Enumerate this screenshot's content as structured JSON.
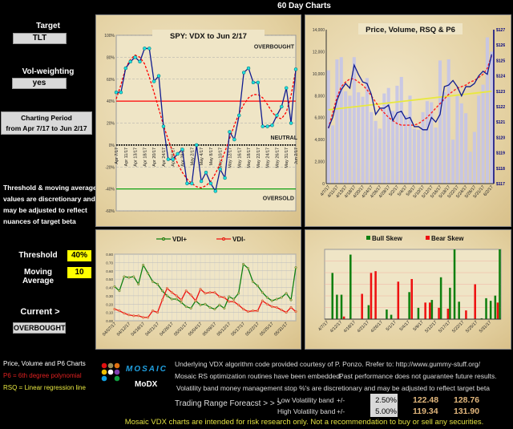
{
  "title": "60 Day Charts",
  "left": {
    "target_label": "Target",
    "target_value": "TLT",
    "vol_label": "Vol-weighting",
    "vol_value": "yes",
    "period_label": "Charting Period",
    "period_value": "from Apr 7/17 to Jun 2/17",
    "note_lines": [
      "Threshold & moving average",
      "values are discretionary and",
      "may be adjusted to reflect",
      "nuances of target beta"
    ],
    "threshold_label": "Threshold",
    "threshold_value": "40%",
    "ma_label": "Moving Average",
    "ma_value": "10",
    "current_label": "Current >",
    "current_value": "OVERBOUGHT",
    "legend_title": "Price, Volume and P6 Charts",
    "legend_p6": "P6 = 6th degree polynomial",
    "legend_rsq": "RSQ = Linear regression line"
  },
  "colors": {
    "p6": "#ff2020",
    "rsq": "#e8e840",
    "bull": "#108010",
    "bear": "#ee1010",
    "vdx": "#101c90",
    "parchment": "#e8d8ae"
  },
  "chart_data": [
    {
      "type": "line",
      "title": "SPY:   VDX to Jun 2/17",
      "ylim": [
        -60,
        100
      ],
      "yticks": [
        "100%",
        "80%",
        "60%",
        "40%",
        "20%",
        "0%",
        "-20%",
        "-40%",
        "-60%"
      ],
      "xlabels": [
        "Apr 7/17",
        "Apr 11/17",
        "Apr 13/17",
        "Apr 18/17",
        "Apr 20/17",
        "Apr 24/17",
        "Apr 26/17",
        "Apr 28/17",
        "May 2/17",
        "May 4/17",
        "May 8/17",
        "May 10/17",
        "May 12/17",
        "May 16/17",
        "May 18/17",
        "May 22/17",
        "May 24/17",
        "May 26/17",
        "May 31/17",
        "Jun 2/17"
      ],
      "annotations": {
        "overbought": "OVERBOUGHT",
        "neutral": "NEUTRAL",
        "oversold": "OVERSOLD"
      },
      "threshold_high": 40,
      "threshold_low": -40,
      "vdx": [
        48,
        48,
        70,
        76,
        80,
        76,
        88,
        88,
        58,
        63,
        17,
        -13,
        -13,
        -8,
        -4,
        -35,
        -35,
        0,
        -33,
        -25,
        -35,
        -42,
        -22,
        -30,
        12,
        5,
        27,
        66,
        70,
        57,
        57,
        17,
        17,
        18,
        27,
        35,
        52,
        20,
        69
      ],
      "moving_average": [
        42,
        55,
        70,
        78,
        82,
        80,
        74,
        62,
        48,
        33,
        18,
        5,
        -7,
        -17,
        -25,
        -31,
        -35,
        -38,
        -39,
        -37,
        -33,
        -26,
        -17,
        -6,
        6,
        18,
        29,
        37,
        43,
        46,
        46,
        43,
        37,
        30,
        25,
        24,
        30,
        45,
        68
      ]
    },
    {
      "type": "bar",
      "title": "Price,  Volume, RSQ & P6",
      "ylim": [
        0,
        14000
      ],
      "y2lim": [
        117,
        127
      ],
      "yticks": [
        "14,000",
        "12,000",
        "10,000",
        "8,000",
        "6,000",
        "4,000",
        "2,000",
        "0"
      ],
      "y2ticks": [
        "$127",
        "$126",
        "$125",
        "$124",
        "$123",
        "$122",
        "$121",
        "$120",
        "$119",
        "$118",
        "$117"
      ],
      "xlabels": [
        "4/7/17",
        "4/11/17",
        "4/13/17",
        "4/18/17",
        "4/20/17",
        "4/24/17",
        "4/26/17",
        "4/28/17",
        "5/2/17",
        "5/4/17",
        "5/8/17",
        "5/10/17",
        "5/12/17",
        "5/16/17",
        "5/18/17",
        "5/22/17",
        "5/24/17",
        "5/26/17",
        "5/31/17",
        "6/2/17"
      ],
      "volume": [
        10300,
        5300,
        11300,
        11500,
        8400,
        8000,
        11500,
        8300,
        7900,
        9600,
        6500,
        5700,
        5000,
        8200,
        8700,
        6600,
        8900,
        9700,
        6200,
        8000,
        5000,
        4900,
        6500,
        7500,
        7400,
        5100,
        11200,
        8300,
        11300,
        4000,
        8000,
        7300,
        6400,
        2900,
        4700,
        8000,
        9000,
        13300,
        12000
      ],
      "price": [
        120.6,
        121.3,
        122.4,
        123.1,
        123.5,
        123.2,
        124.7,
        124.1,
        123.6,
        123.5,
        122.8,
        121.5,
        121.9,
        121.9,
        122.1,
        121.1,
        121.6,
        121.7,
        121.2,
        121.3,
        120.7,
        120.7,
        120.5,
        120.5,
        121.3,
        121.0,
        121.5,
        123.3,
        123.4,
        123.7,
        123.3,
        122.7,
        123.3,
        123.3,
        123.5,
        124.0,
        124.3,
        124.1,
        125.4
      ],
      "rsq": [
        121.8,
        123.0
      ],
      "p6": [
        120.6,
        121.6,
        122.6,
        123.3,
        123.6,
        123.8,
        123.8,
        123.6,
        123.4,
        123.1,
        122.7,
        122.3,
        121.9,
        121.6,
        121.3,
        121.1,
        120.9,
        120.8,
        120.8,
        120.8,
        120.8,
        120.9,
        121.1,
        121.3,
        121.6,
        121.9,
        122.2,
        122.5,
        122.8,
        123.0,
        123.2,
        123.3,
        123.4,
        123.6,
        123.7,
        123.9,
        124.1,
        124.5,
        125.3
      ]
    },
    {
      "type": "line",
      "ylim": [
        0,
        0.8
      ],
      "yticks": [
        "0.80",
        "0.70",
        "0.60",
        "0.50",
        "0.40",
        "0.30",
        "0.20",
        "0.10",
        "0.00"
      ],
      "xlabels": [
        "04/07/17",
        "04/12/17",
        "04/18/17",
        "04/21/17",
        "04/26/17",
        "05/01/17",
        "05/04/17",
        "05/09/17",
        "05/12/17",
        "05/17/17",
        "05/22/17",
        "05/25/17",
        "05/31/17"
      ],
      "series": [
        {
          "name": "VDI+",
          "values": [
            0.41,
            0.36,
            0.53,
            0.52,
            0.53,
            0.44,
            0.67,
            0.57,
            0.47,
            0.44,
            0.36,
            0.3,
            0.26,
            0.26,
            0.22,
            0.17,
            0.15,
            0.24,
            0.19,
            0.2,
            0.16,
            0.14,
            0.19,
            0.15,
            0.29,
            0.26,
            0.33,
            0.68,
            0.63,
            0.47,
            0.42,
            0.34,
            0.28,
            0.24,
            0.26,
            0.28,
            0.33,
            0.25,
            0.64
          ]
        },
        {
          "name": "VDI-",
          "values": [
            0.14,
            0.12,
            0.09,
            0.07,
            0.06,
            0.06,
            0.04,
            0.04,
            0.12,
            0.1,
            0.25,
            0.39,
            0.34,
            0.3,
            0.25,
            0.36,
            0.31,
            0.24,
            0.38,
            0.33,
            0.34,
            0.34,
            0.29,
            0.28,
            0.23,
            0.23,
            0.19,
            0.14,
            0.11,
            0.12,
            0.12,
            0.24,
            0.2,
            0.17,
            0.16,
            0.13,
            0.1,
            0.16,
            0.11
          ]
        }
      ]
    },
    {
      "type": "bar",
      "ylim": [
        0,
        80
      ],
      "xlabels": [
        "4/7/17",
        "4/12/17",
        "4/18/17",
        "4/21/17",
        "4/26/17",
        "5/1/17",
        "5/4/17",
        "5/9/17",
        "5/12/17",
        "5/17/17",
        "5/22/17",
        "5/25/17",
        "5/31/17"
      ],
      "series": [
        {
          "name": "Bull Skew",
          "values": [
            0,
            53,
            28,
            28,
            0,
            74,
            0,
            0,
            0,
            16,
            0,
            0,
            0,
            11,
            5,
            0,
            0,
            0,
            31,
            0,
            13,
            0,
            0,
            22,
            0,
            48,
            0,
            36,
            80,
            20,
            0,
            0,
            0,
            0,
            1,
            24,
            21,
            27,
            80
          ]
        },
        {
          "name": "Bear Skew",
          "values": [
            0,
            0,
            0,
            0,
            3,
            0,
            0,
            0,
            29,
            0,
            53,
            55,
            0,
            0,
            0,
            0,
            43,
            0,
            0,
            46,
            0,
            0,
            19,
            19,
            0,
            13,
            0,
            12,
            0,
            0,
            0,
            10,
            0,
            40,
            0,
            0,
            0,
            0,
            19
          ]
        }
      ]
    }
  ],
  "footer": {
    "logo_text": "MOSAIC",
    "logo_sub": "MoDX",
    "line1": "Underlying VDX algorithm code provided courtesy of P. Ponzo.  Rrefer to:  http://www.gummy-stuff.org/",
    "line2a": "Mosaic RS optimization routines have been embedded.",
    "line2b": "Past performance does not guarantee future results.",
    "line3": "Volatility band money management stop %'s are discretionary and may be adjusted to reflect target beta",
    "trf_label": "Trading Range Foreacst > > >",
    "bands": [
      {
        "label": "Low Volatility band",
        "pm": "+/-",
        "pct": "2.50%",
        "low": "122.48",
        "high": "128.76"
      },
      {
        "label": "High Volatility band",
        "pm": "+/-",
        "pct": "5.00%",
        "low": "119.34",
        "high": "131.90"
      }
    ],
    "disclaimer": "Mosaic VDX charts are intended for risk research only.  Not a recommendation to buy or sell any securities."
  }
}
